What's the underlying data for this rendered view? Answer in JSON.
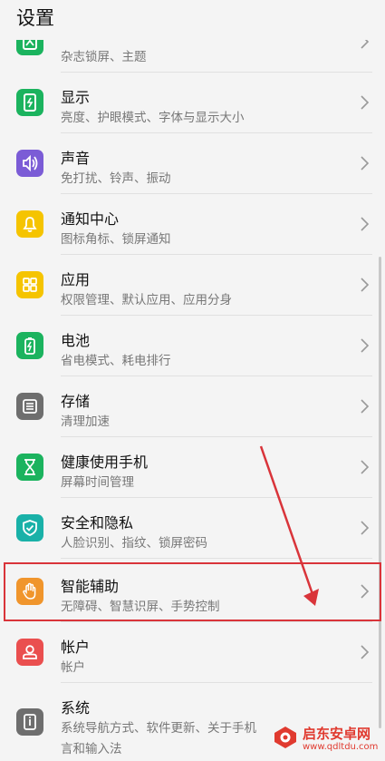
{
  "header": {
    "title": "设置"
  },
  "items": [
    {
      "label": "",
      "sub": "杂志锁屏、主题",
      "icon": "magazine-icon",
      "color": "#1bb35e"
    },
    {
      "label": "显示",
      "sub": "亮度、护眼模式、字体与显示大小",
      "icon": "display-icon",
      "color": "#1bb35e"
    },
    {
      "label": "声音",
      "sub": "免打扰、铃声、振动",
      "icon": "sound-icon",
      "color": "#7b5cd6"
    },
    {
      "label": "通知中心",
      "sub": "图标角标、锁屏通知",
      "icon": "bell-icon",
      "color": "#f5c400"
    },
    {
      "label": "应用",
      "sub": "权限管理、默认应用、应用分身",
      "icon": "apps-icon",
      "color": "#f5c400"
    },
    {
      "label": "电池",
      "sub": "省电模式、耗电排行",
      "icon": "battery-icon",
      "color": "#1bb35e"
    },
    {
      "label": "存储",
      "sub": "清理加速",
      "icon": "storage-icon",
      "color": "#6e6e6e"
    },
    {
      "label": "健康使用手机",
      "sub": "屏幕时间管理",
      "icon": "hourglass-icon",
      "color": "#1bb35e"
    },
    {
      "label": "安全和隐私",
      "sub": "人脸识别、指纹、锁屏密码",
      "icon": "shield-icon",
      "color": "#19b1a8"
    },
    {
      "label": "智能辅助",
      "sub": "无障碍、智慧识屏、手势控制",
      "icon": "hand-icon",
      "color": "#f0952c"
    },
    {
      "label": "帐户",
      "sub": "帐户",
      "icon": "account-icon",
      "color": "#ea4f4f"
    },
    {
      "label": "系统",
      "sub": "系统导航方式、软件更新、关于手机",
      "sub2": "言和输入法",
      "icon": "system-icon",
      "color": "#6e6e6e"
    }
  ],
  "watermark": {
    "name": "启东安卓网",
    "url": "www.qdltdu.com"
  }
}
